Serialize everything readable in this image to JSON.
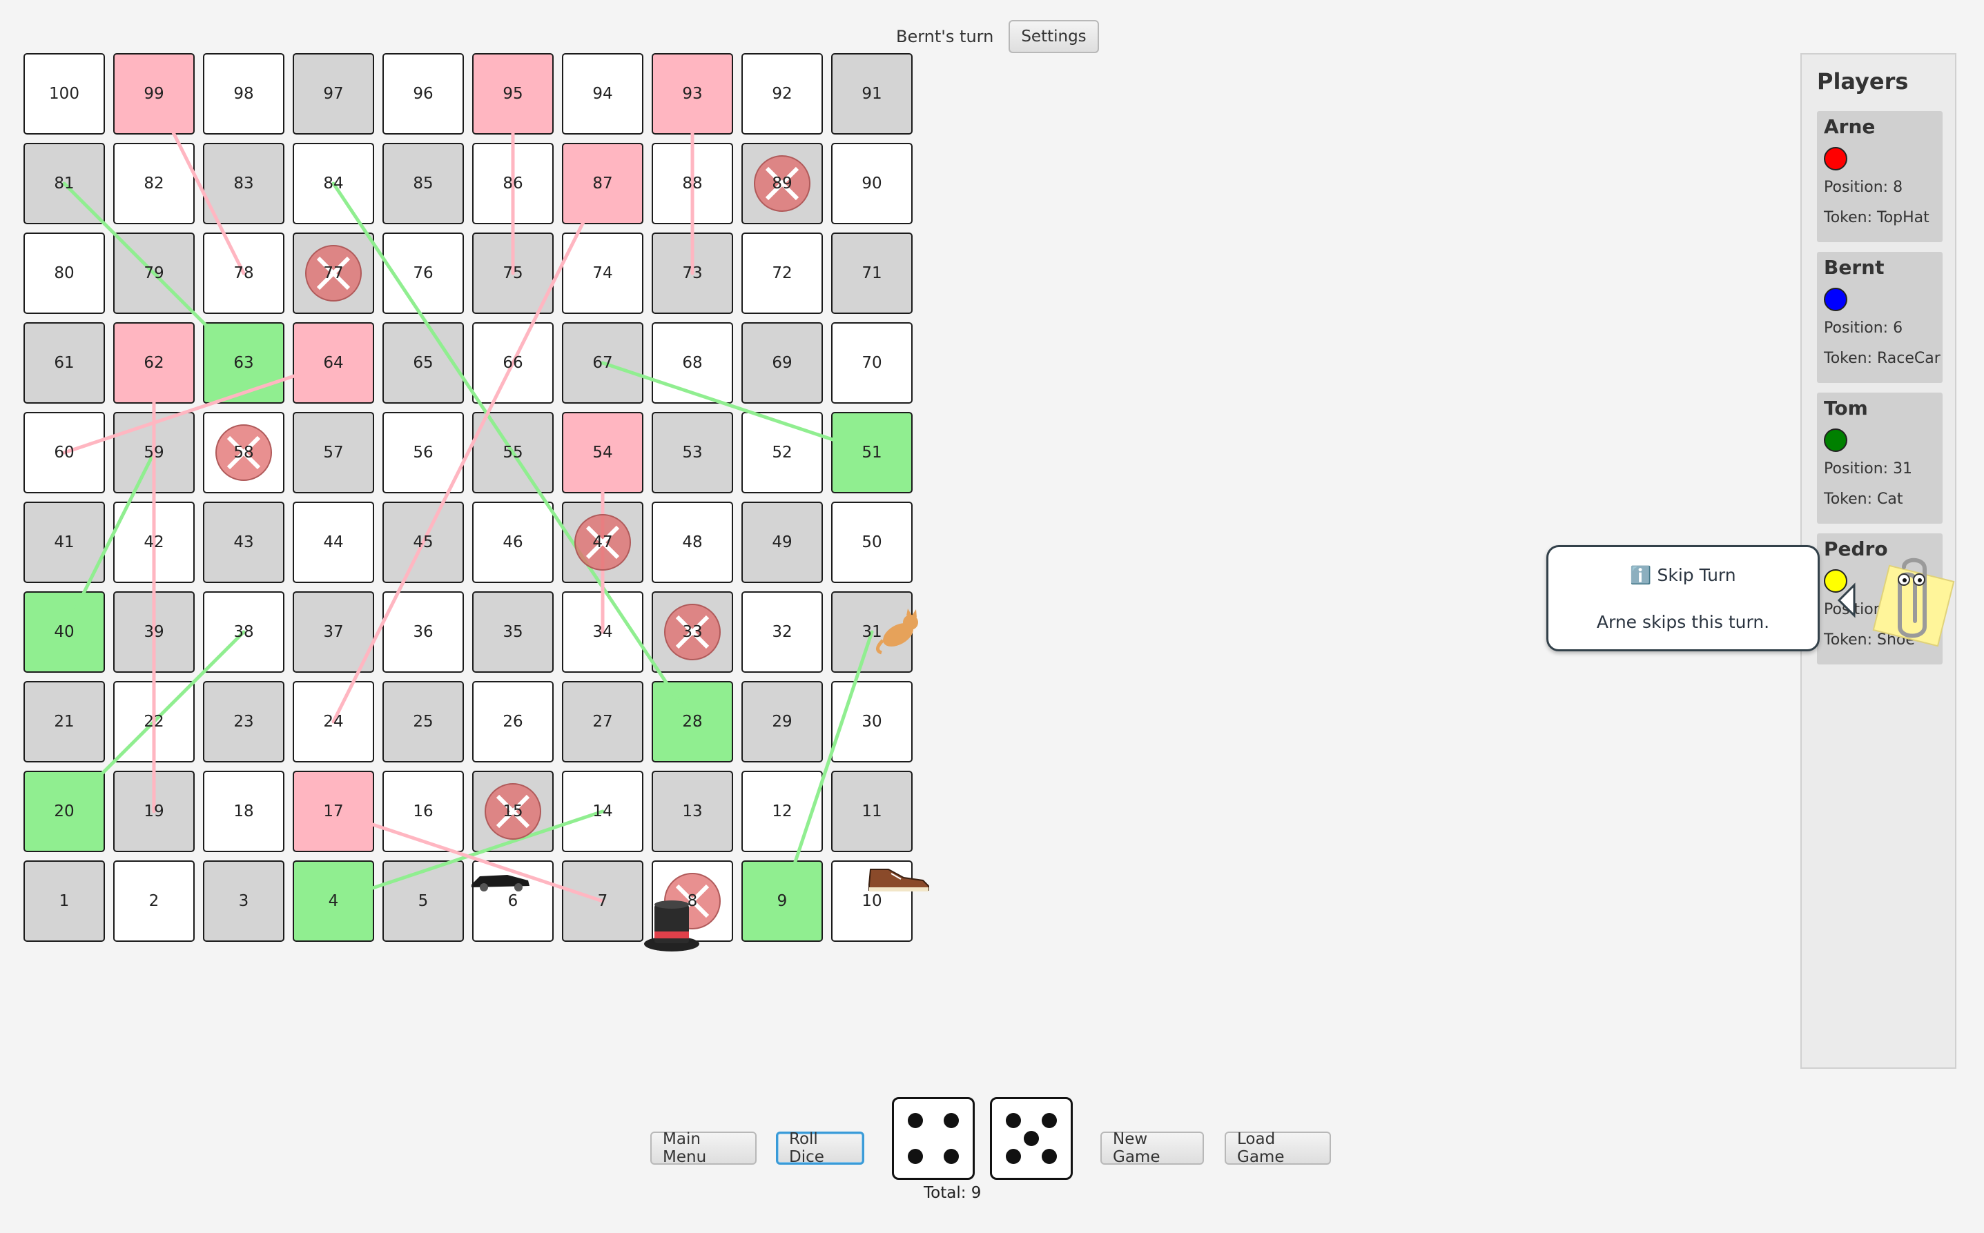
{
  "header": {
    "turn_text": "Bernt's turn",
    "settings_label": "Settings"
  },
  "board": {
    "cells": [
      {
        "n": "100",
        "c": "white"
      },
      {
        "n": "99",
        "c": "pink"
      },
      {
        "n": "98",
        "c": "white"
      },
      {
        "n": "97",
        "c": "gray"
      },
      {
        "n": "96",
        "c": "white"
      },
      {
        "n": "95",
        "c": "pink"
      },
      {
        "n": "94",
        "c": "white"
      },
      {
        "n": "93",
        "c": "pink"
      },
      {
        "n": "92",
        "c": "white"
      },
      {
        "n": "91",
        "c": "gray"
      },
      {
        "n": "81",
        "c": "gray"
      },
      {
        "n": "82",
        "c": "white"
      },
      {
        "n": "83",
        "c": "gray"
      },
      {
        "n": "84",
        "c": "white"
      },
      {
        "n": "85",
        "c": "gray"
      },
      {
        "n": "86",
        "c": "white"
      },
      {
        "n": "87",
        "c": "pink"
      },
      {
        "n": "88",
        "c": "white"
      },
      {
        "n": "89",
        "c": "gray"
      },
      {
        "n": "90",
        "c": "white"
      },
      {
        "n": "80",
        "c": "white"
      },
      {
        "n": "79",
        "c": "gray"
      },
      {
        "n": "78",
        "c": "white"
      },
      {
        "n": "77",
        "c": "gray"
      },
      {
        "n": "76",
        "c": "white"
      },
      {
        "n": "75",
        "c": "gray"
      },
      {
        "n": "74",
        "c": "white"
      },
      {
        "n": "73",
        "c": "gray"
      },
      {
        "n": "72",
        "c": "white"
      },
      {
        "n": "71",
        "c": "gray"
      },
      {
        "n": "61",
        "c": "gray"
      },
      {
        "n": "62",
        "c": "pink"
      },
      {
        "n": "63",
        "c": "green"
      },
      {
        "n": "64",
        "c": "pink"
      },
      {
        "n": "65",
        "c": "gray"
      },
      {
        "n": "66",
        "c": "white"
      },
      {
        "n": "67",
        "c": "gray"
      },
      {
        "n": "68",
        "c": "white"
      },
      {
        "n": "69",
        "c": "gray"
      },
      {
        "n": "70",
        "c": "white"
      },
      {
        "n": "60",
        "c": "white"
      },
      {
        "n": "59",
        "c": "gray"
      },
      {
        "n": "58",
        "c": "white"
      },
      {
        "n": "57",
        "c": "gray"
      },
      {
        "n": "56",
        "c": "white"
      },
      {
        "n": "55",
        "c": "gray"
      },
      {
        "n": "54",
        "c": "pink"
      },
      {
        "n": "53",
        "c": "gray"
      },
      {
        "n": "52",
        "c": "white"
      },
      {
        "n": "51",
        "c": "green"
      },
      {
        "n": "41",
        "c": "gray"
      },
      {
        "n": "42",
        "c": "white"
      },
      {
        "n": "43",
        "c": "gray"
      },
      {
        "n": "44",
        "c": "white"
      },
      {
        "n": "45",
        "c": "gray"
      },
      {
        "n": "46",
        "c": "white"
      },
      {
        "n": "47",
        "c": "gray"
      },
      {
        "n": "48",
        "c": "white"
      },
      {
        "n": "49",
        "c": "gray"
      },
      {
        "n": "50",
        "c": "white"
      },
      {
        "n": "40",
        "c": "green"
      },
      {
        "n": "39",
        "c": "gray"
      },
      {
        "n": "38",
        "c": "white"
      },
      {
        "n": "37",
        "c": "gray"
      },
      {
        "n": "36",
        "c": "white"
      },
      {
        "n": "35",
        "c": "gray"
      },
      {
        "n": "34",
        "c": "white"
      },
      {
        "n": "33",
        "c": "gray"
      },
      {
        "n": "32",
        "c": "white"
      },
      {
        "n": "31",
        "c": "gray"
      },
      {
        "n": "21",
        "c": "gray"
      },
      {
        "n": "22",
        "c": "white"
      },
      {
        "n": "23",
        "c": "gray"
      },
      {
        "n": "24",
        "c": "white"
      },
      {
        "n": "25",
        "c": "gray"
      },
      {
        "n": "26",
        "c": "white"
      },
      {
        "n": "27",
        "c": "gray"
      },
      {
        "n": "28",
        "c": "green"
      },
      {
        "n": "29",
        "c": "gray"
      },
      {
        "n": "30",
        "c": "white"
      },
      {
        "n": "20",
        "c": "green"
      },
      {
        "n": "19",
        "c": "gray"
      },
      {
        "n": "18",
        "c": "white"
      },
      {
        "n": "17",
        "c": "pink"
      },
      {
        "n": "16",
        "c": "white"
      },
      {
        "n": "15",
        "c": "gray"
      },
      {
        "n": "14",
        "c": "white"
      },
      {
        "n": "13",
        "c": "gray"
      },
      {
        "n": "12",
        "c": "white"
      },
      {
        "n": "11",
        "c": "gray"
      },
      {
        "n": "1",
        "c": "gray"
      },
      {
        "n": "2",
        "c": "white"
      },
      {
        "n": "3",
        "c": "gray"
      },
      {
        "n": "4",
        "c": "green"
      },
      {
        "n": "5",
        "c": "gray"
      },
      {
        "n": "6",
        "c": "white"
      },
      {
        "n": "7",
        "c": "gray"
      },
      {
        "n": "8",
        "c": "white"
      },
      {
        "n": "9",
        "c": "green"
      },
      {
        "n": "10",
        "c": "white"
      }
    ],
    "ladders": [
      [
        "4",
        "14"
      ],
      [
        "9",
        "31"
      ],
      [
        "20",
        "38"
      ],
      [
        "28",
        "84"
      ],
      [
        "40",
        "59"
      ],
      [
        "51",
        "67"
      ],
      [
        "63",
        "81"
      ]
    ],
    "snakes": [
      [
        "17",
        "7"
      ],
      [
        "24",
        "87"
      ],
      [
        "54",
        "34"
      ],
      [
        "62",
        "19"
      ],
      [
        "64",
        "60"
      ],
      [
        "93",
        "73"
      ],
      [
        "95",
        "75"
      ],
      [
        "99",
        "78"
      ]
    ],
    "skip_cells": [
      "89",
      "77",
      "58",
      "47",
      "33",
      "15",
      "8"
    ],
    "tokens": [
      {
        "player": "Arne",
        "token": "TopHat",
        "cell": "8"
      },
      {
        "player": "Bernt",
        "token": "RaceCar",
        "cell": "6"
      },
      {
        "player": "Tom",
        "token": "Cat",
        "cell": "31"
      },
      {
        "player": "Pedro",
        "token": "Shoe",
        "cell": "10"
      }
    ]
  },
  "players_panel": {
    "title": "Players",
    "players": [
      {
        "name": "Arne",
        "color": "#ff0000",
        "position": "Position: 8",
        "token": "Token: TopHat"
      },
      {
        "name": "Bernt",
        "color": "#0000ff",
        "position": "Position: 6",
        "token": "Token: RaceCar"
      },
      {
        "name": "Tom",
        "color": "#008000",
        "position": "Position: 31",
        "token": "Token: Cat"
      },
      {
        "name": "Pedro",
        "color": "#ffff00",
        "position": "Position: 16",
        "token": "Token: Shoe"
      }
    ]
  },
  "notification": {
    "title": "ℹ️ Skip Turn",
    "message": "Arne skips this turn."
  },
  "controls": {
    "main_menu_label": "Main Menu",
    "roll_dice_label": "Roll Dice",
    "new_game_label": "New Game",
    "load_game_label": "Load Game",
    "dice": [
      4,
      5
    ],
    "total_text": "Total: 9"
  },
  "colors": {
    "ladder": "#90ee90",
    "snake": "#ffb6c1",
    "skip": "#e06b6b",
    "focus": "#3a9bd8"
  }
}
